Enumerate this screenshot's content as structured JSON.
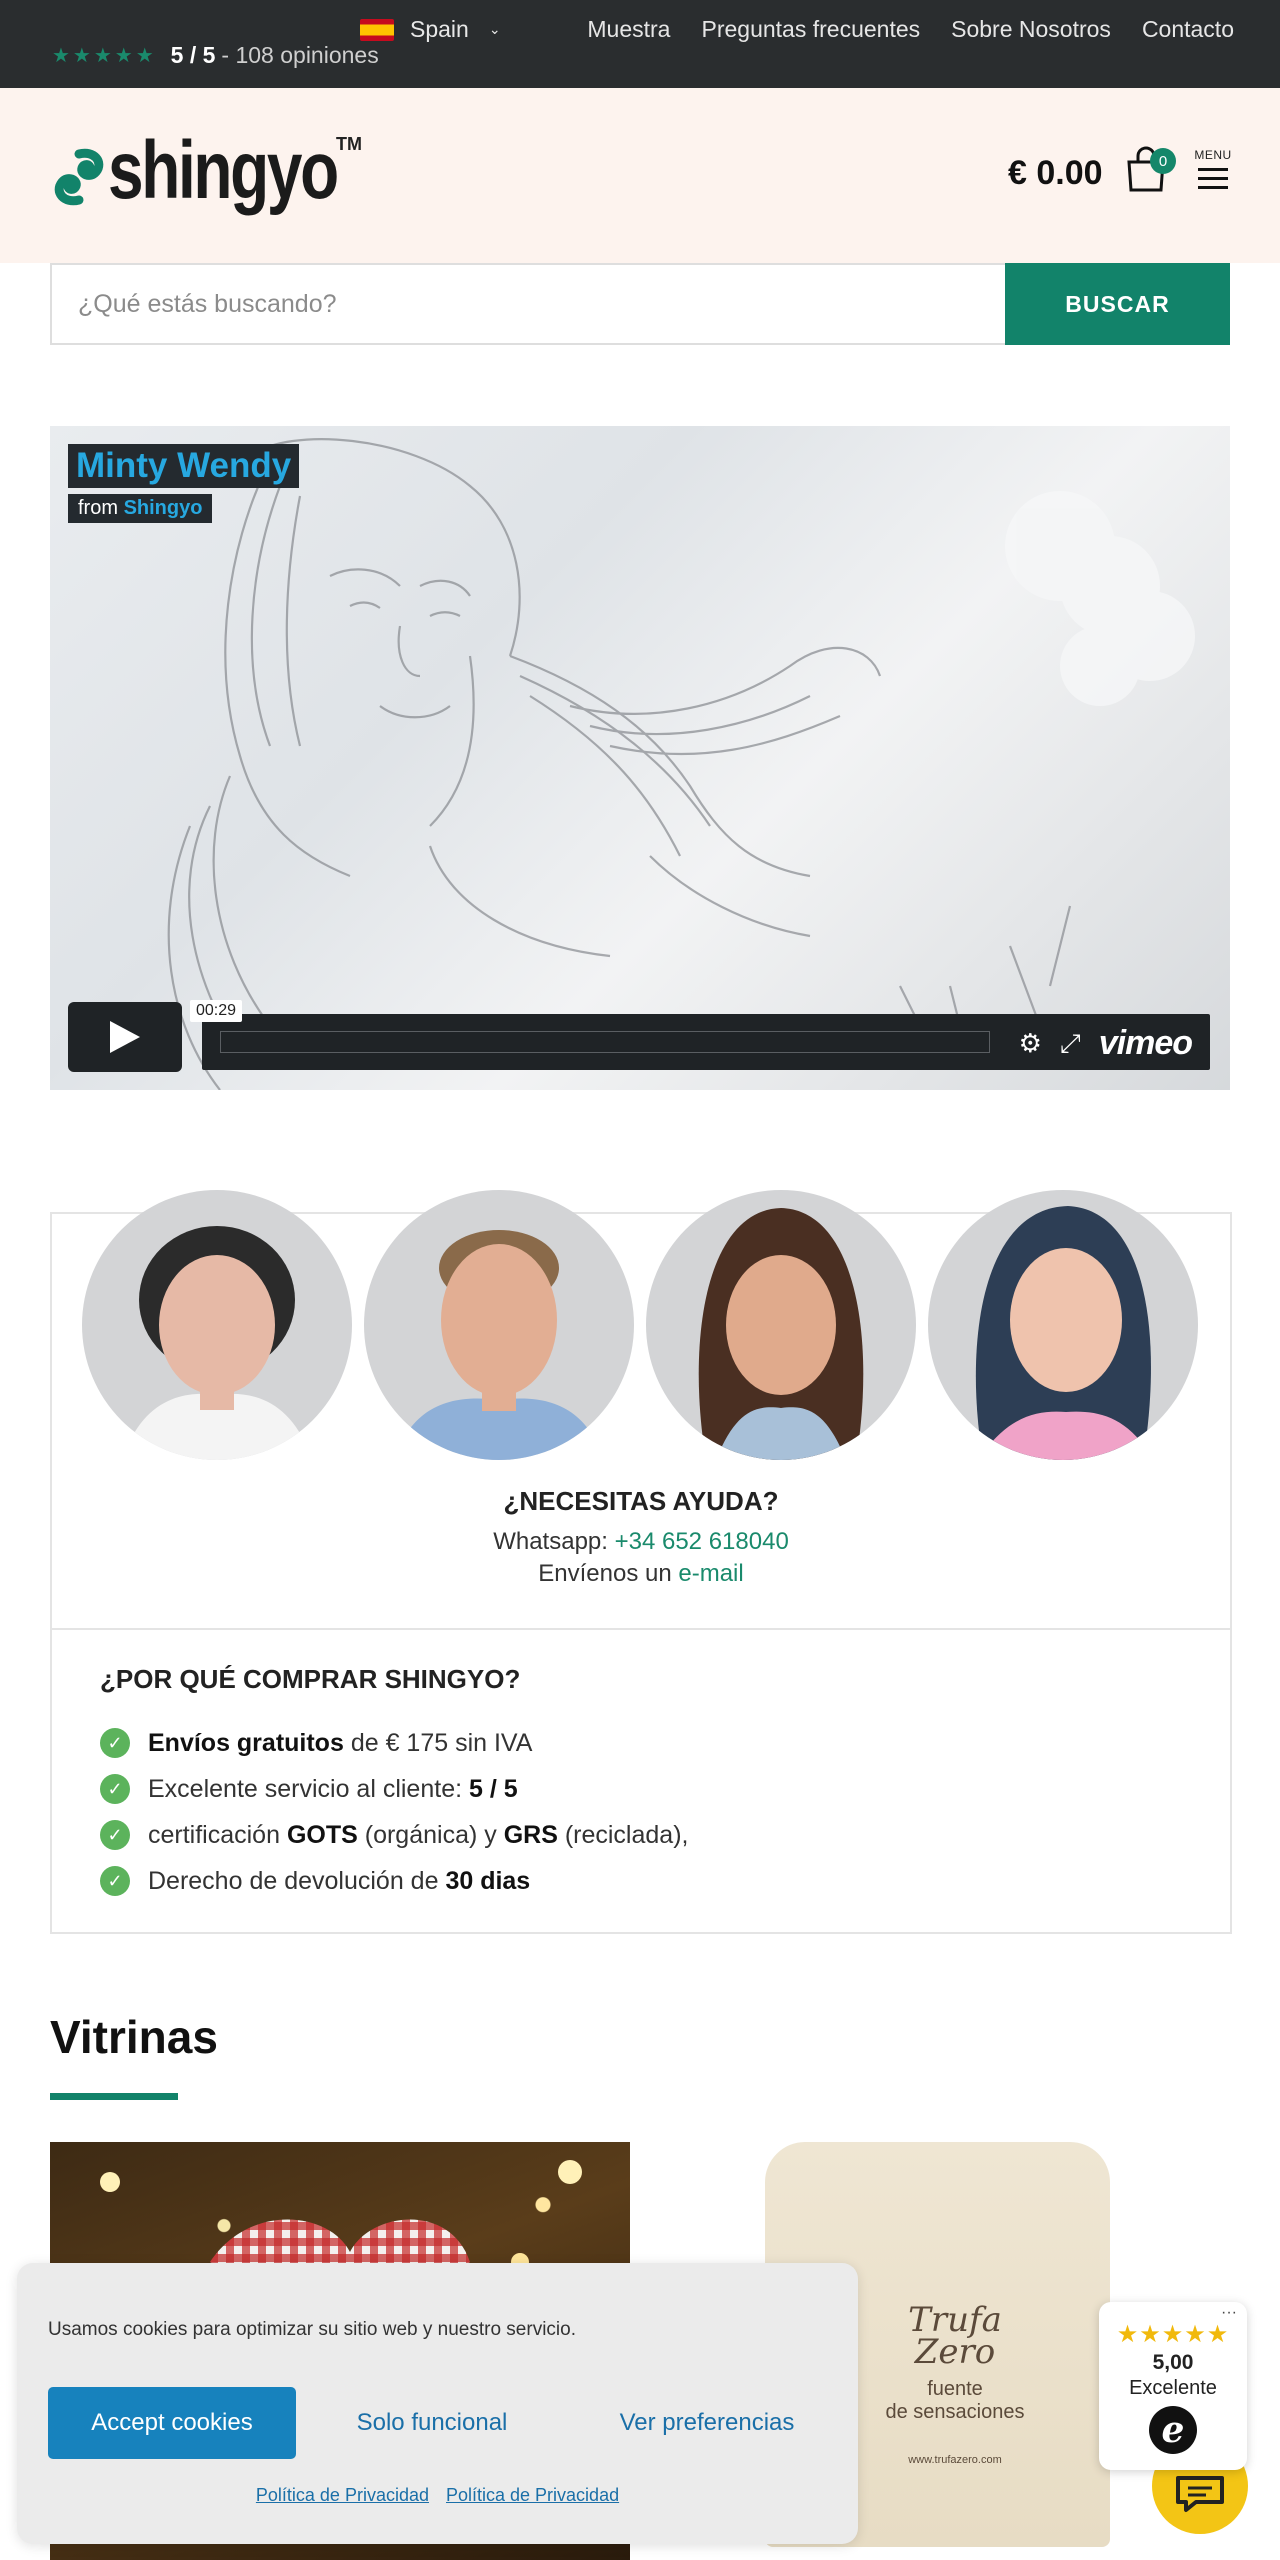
{
  "topbar": {
    "stars": "★★★★★",
    "rating_score": "5 / 5",
    "rating_rest": "- 108 opiniones",
    "language": "Spain",
    "nav": [
      "Muestra",
      "Preguntas frecuentes",
      "Sobre Nosotros",
      "Contacto"
    ]
  },
  "header": {
    "logo_text": "shingyo",
    "tm": "TM",
    "cart_total": "€ 0.00",
    "cart_count": "0",
    "menu_label": "MENU"
  },
  "search": {
    "placeholder": "¿Qué estás buscando?",
    "button": "BUSCAR"
  },
  "video": {
    "title": "Minty Wendy",
    "from_prefix": "from",
    "from_name": "Shingyo",
    "timecode": "00:29",
    "brand": "vimeo"
  },
  "help": {
    "heading": "¿NECESITAS AYUDA?",
    "whatsapp_label": "Whatsapp:",
    "whatsapp_number": "+34 652 618040",
    "email_prefix": "Envíenos un",
    "email_link": "e-mail"
  },
  "why": {
    "heading": "¿POR QUÉ COMPRAR SHINGYO?",
    "reasons": [
      {
        "pre": "",
        "bold": "Envíos gratuitos",
        "post": " de € 175 sin IVA"
      },
      {
        "pre": "Excelente servicio al cliente: ",
        "bold": "5 / 5",
        "post": ""
      },
      {
        "pre": "certificación ",
        "bold": "GOTS",
        "post": " (orgánica) y ",
        "bold2": "GRS",
        "post2": " (reciclada),"
      },
      {
        "pre": "Derecho de devolución de ",
        "bold": "30 dias",
        "post": ""
      }
    ]
  },
  "vitrinas": {
    "title": "Vitrinas"
  },
  "product_bag": {
    "brand1": "Trufa",
    "brand2": "Zero",
    "tagline1": "fuente",
    "tagline2": "de sensaciones",
    "url": "www.trufazero.com"
  },
  "cookie": {
    "message": "Usamos cookies para optimizar su sitio web y nuestro servicio.",
    "accept": "Accept cookies",
    "functional": "Solo funcional",
    "preferences": "Ver preferencias",
    "privacy1": "Política de Privacidad",
    "privacy2": "Política de Privacidad"
  },
  "trust": {
    "stars": "★★★★★",
    "score": "5,00",
    "label": "Excelente",
    "logo": "e",
    "more": "···"
  },
  "colors": {
    "accent": "#12836a",
    "topbar": "#2a2d2f",
    "header_bg": "#fdf3ee",
    "cookie_button": "#1782bd"
  }
}
